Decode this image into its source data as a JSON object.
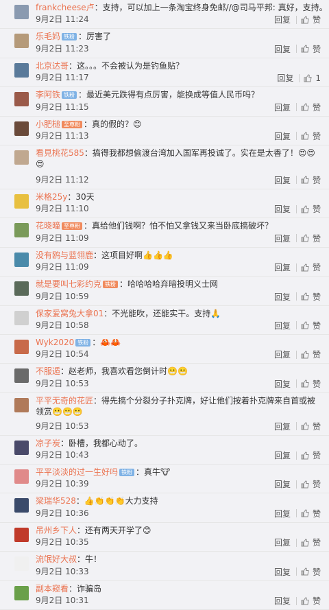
{
  "comments": [
    {
      "name": "frankcheese卢",
      "badge": "",
      "badge_type": "",
      "text": "：支持，可以加上一条淘宝终身免邮//@司马平邦: 真好，支持。",
      "time": "9月2日 11:24",
      "reply": "回复",
      "like": "赞",
      "avatar": "#8a9ab0"
    },
    {
      "name": "乐毛妈",
      "badge": "铁粉",
      "badge_type": "fan",
      "text": "：厉害了",
      "time": "9月2日 11:23",
      "reply": "回复",
      "like": "赞",
      "avatar": "#b59a7a"
    },
    {
      "name": "北京达哥",
      "badge": "",
      "badge_type": "",
      "text": "：这。。。不会被认为是钓鱼贴？",
      "time": "9月2日 11:17",
      "reply": "回复",
      "like": "1",
      "avatar": "#5a7a9a"
    },
    {
      "name": "李阿铁",
      "badge": "铁粉",
      "badge_type": "fan",
      "text": "：最近美元跌得有点厉害，能换成等值人民币吗？",
      "time": "9月2日 11:15",
      "reply": "回复",
      "like": "赞",
      "avatar": "#9a5a4a"
    },
    {
      "name": "小肥槌",
      "badge": "至尊粉",
      "badge_type": "iron",
      "text": "：真的假的？😊",
      "time": "9月2日 11:13",
      "reply": "回复",
      "like": "赞",
      "avatar": "#6a4a3a"
    },
    {
      "name": "看見桃花585",
      "badge": "",
      "badge_type": "",
      "text": "：搞得我都想偷渡台湾加入国军再投诚了。实在是太香了！😍😍😍",
      "time": "9月2日 11:12",
      "reply": "回复",
      "like": "赞",
      "avatar": "#c0a890"
    },
    {
      "name": "米格25y",
      "badge": "",
      "badge_type": "",
      "text": "：30天",
      "time": "9月2日 11:10",
      "reply": "回复",
      "like": "赞",
      "avatar": "#e8c040"
    },
    {
      "name": "花晓曈",
      "badge": "至尊粉",
      "badge_type": "iron",
      "text": "：真给他们钱啊？怕不怕又拿钱又来当卧底搞破坏？",
      "time": "9月2日 11:09",
      "reply": "回复",
      "like": "赞",
      "avatar": "#7a9a5a"
    },
    {
      "name": "没有鸥与蓝翎鹿",
      "badge": "",
      "badge_type": "",
      "text": "：这项目好啊👍👍👍",
      "time": "9月2日 11:09",
      "reply": "回复",
      "like": "赞",
      "avatar": "#4a8aaa"
    },
    {
      "name": "就是要叫七彩约克",
      "badge": "铁粉",
      "badge_type": "iron",
      "text": "：哈哈哈哈弃暗投明义士网",
      "time": "9月2日 10:59",
      "reply": "回复",
      "like": "赞",
      "avatar": "#5a6a5a"
    },
    {
      "name": "保家爱窝兔大拿01",
      "badge": "",
      "badge_type": "",
      "text": "：不光能吹，还能实干。支持🙏",
      "time": "9月2日 10:58",
      "reply": "回复",
      "like": "赞",
      "avatar": "#d0d0d0"
    },
    {
      "name": "Wyk2020",
      "badge": "铁粉",
      "badge_type": "fan",
      "text": "：🦀🦀",
      "time": "9月2日 10:54",
      "reply": "回复",
      "like": "赞",
      "avatar": "#c86a4a"
    },
    {
      "name": "不服遁",
      "badge": "",
      "badge_type": "",
      "text": "：赵老师，我喜欢看您倒计时😬😬",
      "time": "9月2日 10:53",
      "reply": "回复",
      "like": "赞",
      "avatar": "#6a6a6a"
    },
    {
      "name": "平平无奇的花匠",
      "badge": "",
      "badge_type": "",
      "text": "：得先搞个分裂分子扑克牌，好让他们按着扑克牌来自首或被领赏😬😬😬",
      "time": "9月2日 10:53",
      "reply": "回复",
      "like": "赞",
      "avatar": "#b07a5a"
    },
    {
      "name": "凉子炭",
      "badge": "",
      "badge_type": "",
      "text": "：卧槽，我都心动了。",
      "time": "9月2日 10:43",
      "reply": "回复",
      "like": "赞",
      "avatar": "#4a4a6a"
    },
    {
      "name": "平平淡淡的过一生好吗",
      "badge": "铁粉",
      "badge_type": "fan",
      "text": "：真牛🐮",
      "time": "9月2日 10:39",
      "reply": "回复",
      "like": "赞",
      "avatar": "#e08a8a"
    },
    {
      "name": "梁瑞华528",
      "badge": "",
      "badge_type": "",
      "text": "：👍👏👏👏大力支持",
      "time": "9月2日 10:36",
      "reply": "回复",
      "like": "赞",
      "avatar": "#3a4a6a"
    },
    {
      "name": "吊州乡下人",
      "badge": "",
      "badge_type": "",
      "text": "：还有两天开学了😊",
      "time": "9月2日 10:35",
      "reply": "回复",
      "like": "赞",
      "avatar": "#c03a2a"
    },
    {
      "name": "流氓好大叔",
      "badge": "",
      "badge_type": "",
      "text": "：牛！",
      "time": "9月2日 10:33",
      "reply": "回复",
      "like": "赞",
      "avatar": "#f0f0f0"
    },
    {
      "name": "副本窥看",
      "badge": "",
      "badge_type": "",
      "text": "：诈骗岛",
      "time": "9月2日 10:31",
      "reply": "回复",
      "like": "赞",
      "avatar": "#6aa04a"
    }
  ]
}
